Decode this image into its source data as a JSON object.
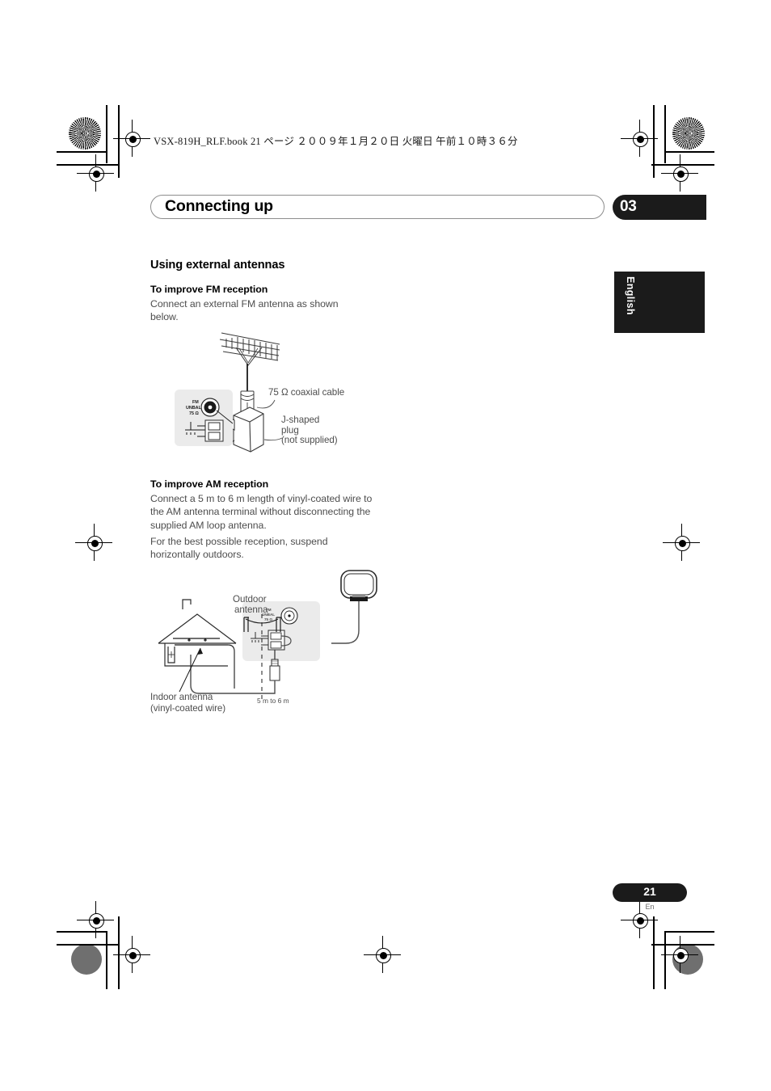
{
  "print_header": {
    "book_line": "VSX-819H_RLF.book   21 ページ   ２００９年１月２０日   火曜日   午前１０時３６分"
  },
  "header": {
    "chapter_title": "Connecting up",
    "chapter_number": "03"
  },
  "side_tab": {
    "language": "English"
  },
  "main": {
    "section_heading": "Using external antennas",
    "fm": {
      "heading": "To improve FM reception",
      "paragraph": "Connect an external FM antenna as shown below."
    },
    "am": {
      "heading": "To improve AM reception",
      "paragraph_1": "Connect a 5 m to 6 m length of vinyl-coated wire to the AM antenna terminal without disconnecting the supplied AM loop antenna.",
      "paragraph_2": "For the best possible reception, suspend horizontally outdoors."
    }
  },
  "fm_diagram": {
    "coax_label": "75 Ω coaxial cable",
    "plug_label_1": "J-shaped",
    "plug_label_2": "plug",
    "plug_label_3": "(not supplied)",
    "terminal_line_1": "FM",
    "terminal_line_2": "UNBAL",
    "terminal_line_3": "75 Ω"
  },
  "am_diagram": {
    "outdoor_label_1": "Outdoor",
    "outdoor_label_2": "antenna",
    "indoor_label_1": "Indoor antenna",
    "indoor_label_2": "(vinyl-coated wire)",
    "length_label": "5 m to 6 m",
    "terminal_line_1": "FM",
    "terminal_line_2": "UNBAL",
    "terminal_line_3": "75 Ω"
  },
  "footer": {
    "page_number": "21",
    "page_language": "En"
  },
  "colors": {
    "accent_black": "#1b1b1b",
    "body_text": "#4d4d4d",
    "panel_gray": "#ebebeb"
  }
}
